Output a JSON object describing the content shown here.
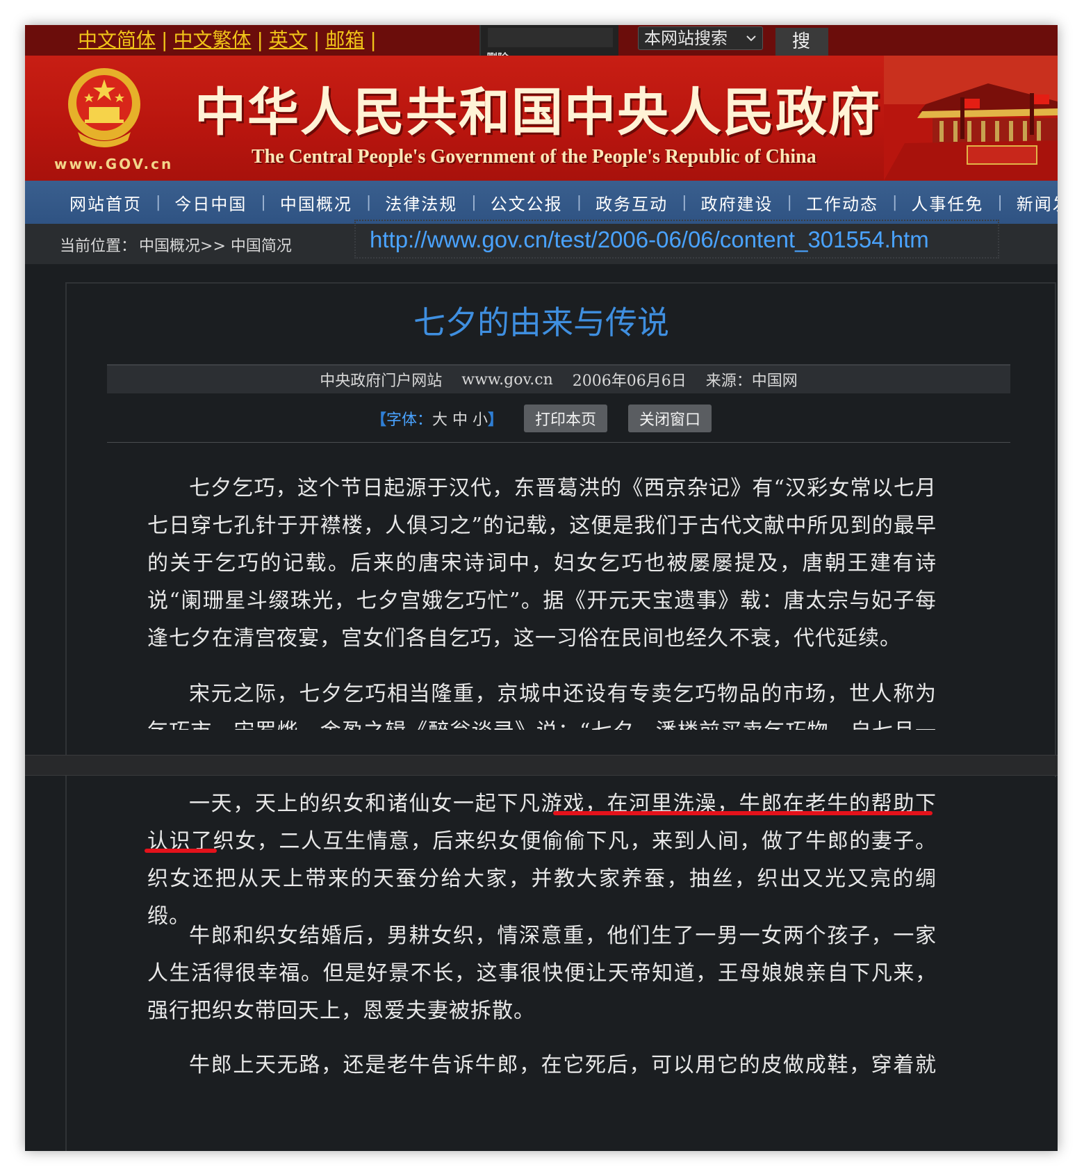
{
  "topbar": {
    "langs": [
      "中文简体",
      "中文繁体",
      "英文",
      "邮箱"
    ],
    "truncated_text": "删除",
    "search_scope": "本网站搜索",
    "search_button": "搜 索"
  },
  "banner": {
    "site_url": "www.GOV.cn",
    "title_zh": "中华人民共和国中央人民政府",
    "title_en": "The Central People's Government of the People's Republic of China"
  },
  "nav": [
    "网站首页",
    "今日中国",
    "中国概况",
    "法律法规",
    "公文公报",
    "政务互动",
    "政府建设",
    "工作动态",
    "人事任免",
    "新闻发布"
  ],
  "breadcrumb": {
    "label": "当前位置：",
    "path": "中国概况>> 中国简况"
  },
  "url_overlay": "http://www.gov.cn/test/2006-06/06/content_301554.htm",
  "article": {
    "title": "七夕的由来与传说",
    "meta_site": "中央政府门户网站",
    "meta_domain": "www.gov.cn",
    "meta_date": "2006年06月6日",
    "meta_source": "来源：中国网",
    "font_open": "【",
    "font_label": "字体：",
    "font_sizes": "大 中 小",
    "font_close": "】",
    "print_button": "打印本页",
    "close_button": "关闭窗口",
    "paragraphs": [
      "七夕乞巧，这个节日起源于汉代，东晋葛洪的《西京杂记》有“汉彩女常以七月七日穿七孔针于开襟楼，人俱习之”的记载，这便是我们于古代文献中所见到的最早的关于乞巧的记载。后来的唐宋诗词中，妇女乞巧也被屡屡提及，唐朝王建有诗说“阑珊星斗缀珠光，七夕宫娥乞巧忙”。据《开元天宝遗事》载：唐太宗与妃子每逢七夕在清宫夜宴，宫女们各自乞巧，这一习俗在民间也经久不衰，代代延续。",
      "宋元之际，七夕乞巧相当隆重，京城中还设有专卖乞巧物品的市场，世人称为乞巧市。宋罗烨、金盈之辑《醉翁谈录》说：“七夕，潘楼前买卖乞巧物。自七月一日，车"
    ],
    "lower_paragraphs": [
      "一天，天上的织女和诸仙女一起下凡游戏，在河里洗澡，牛郎在老牛的帮助下认识了织女，二人互生情意，后来织女便偷偷下凡，来到人间，做了牛郎的妻子。织女还把从天上带来的天蚕分给大家，并教大家养蚕，抽丝，织出又光又亮的绸缎。",
      "牛郎和织女结婚后，男耕女织，情深意重，他们生了一男一女两个孩子，一家人生活得很幸福。但是好景不长，这事很快便让天帝知道，王母娘娘亲自下凡来，强行把织女带回天上，恩爱夫妻被拆散。",
      "牛郎上天无路，还是老牛告诉牛郎，在它死后，可以用它的皮做成鞋，穿着就可以"
    ]
  },
  "colors": {
    "banner_red": "#c81e14",
    "nav_blue": "#2f5383",
    "link_gold": "#f0c419",
    "title_blue": "#3f8fe0",
    "annotation_red": "#e4121b"
  },
  "icons": [
    "national-emblem-icon",
    "tiananmen-gate-icon",
    "chevron-down-icon"
  ]
}
